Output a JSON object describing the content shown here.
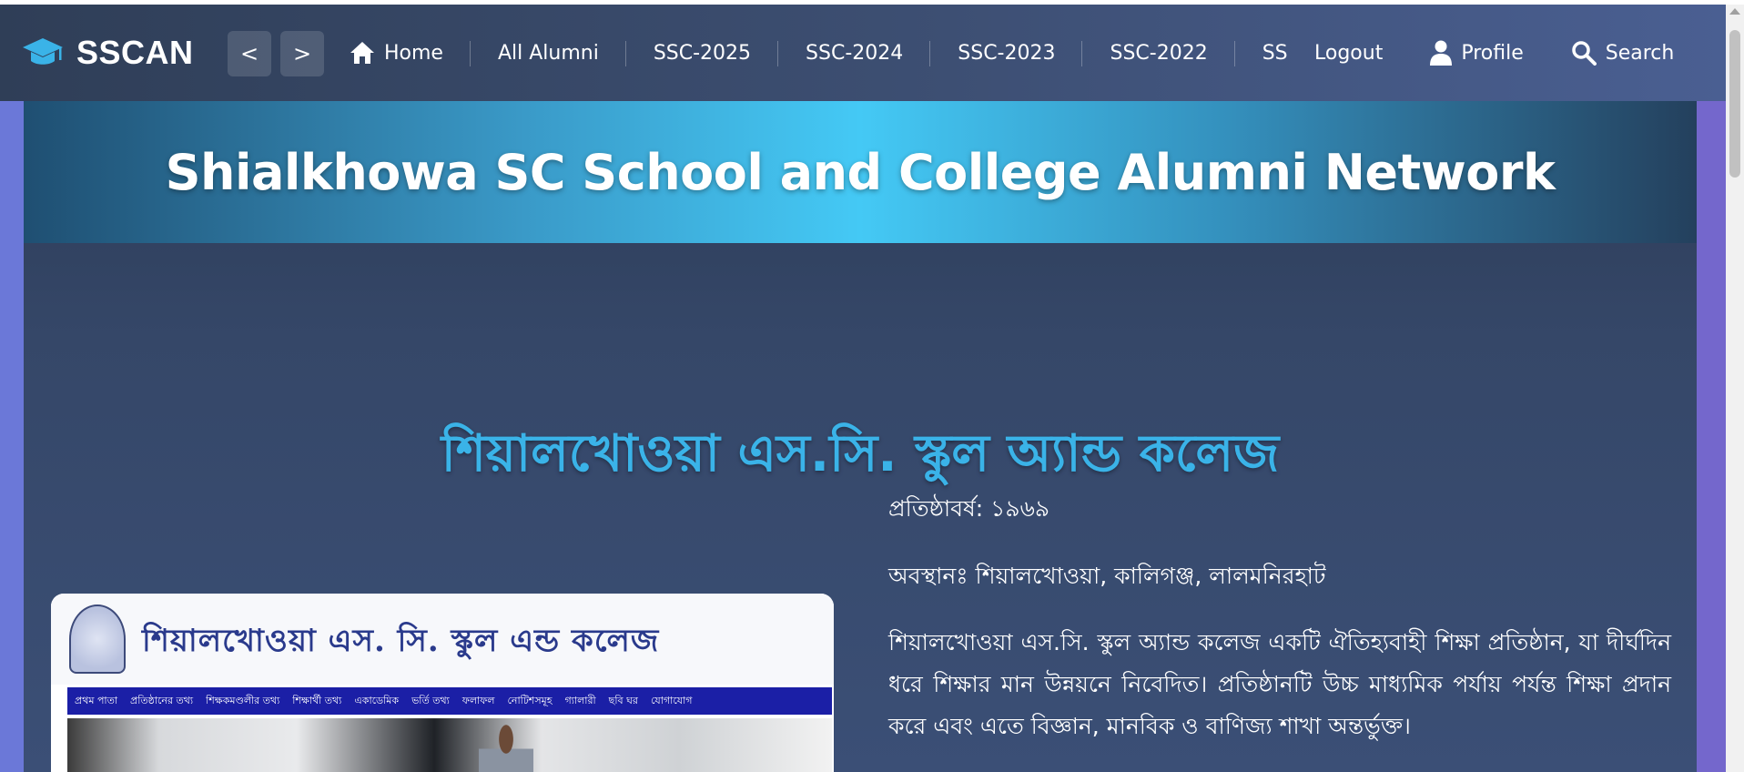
{
  "brand": {
    "name": "SSCAN",
    "icon": "graduation-cap-icon"
  },
  "nav": {
    "back_label": "<",
    "forward_label": ">",
    "items": [
      {
        "label": "Home",
        "icon": "home-icon"
      },
      {
        "label": "All Alumni"
      },
      {
        "label": "SSC-2025"
      },
      {
        "label": "SSC-2024"
      },
      {
        "label": "SSC-2023"
      },
      {
        "label": "SSC-2022"
      },
      {
        "label": "SSC-"
      }
    ],
    "logout_label": "Logout",
    "profile_label": "Profile",
    "search_label": "Search"
  },
  "hero": {
    "title": "Shialkhowa SC School and College Alumni Network"
  },
  "school": {
    "title": "শিয়ালখোওয়া এস.সি. স্কুল অ্যান্ড কলেজ",
    "established": "প্রতিষ্ঠাবর্ষ: ১৯৬৯",
    "location": "অবস্থানঃ শিয়ালখোওয়া, কালিগঞ্জ, লালমনিরহাট",
    "description": "শিয়ালখোওয়া এস.সি. স্কুল অ্যান্ড কলেজ একটি ঐতিহ্যবাহী শিক্ষা প্রতিষ্ঠান, যা দীর্ঘদিন ধরে শিক্ষার মান উন্নয়নে নিবেদিত। প্রতিষ্ঠানটি উচ্চ মাধ্যমিক পর্যায় পর্যন্ত শিক্ষা প্রদান করে এবং এতে বিজ্ঞান, মানবিক ও বাণিজ্য শাখা অন্তর্ভুক্ত।"
  },
  "website_preview": {
    "title": "শিয়ালখোওয়া এস. সি. স্কুল এন্ড কলেজ",
    "nav_items": [
      "প্রথম পাতা",
      "প্রতিষ্ঠানের তথ্য",
      "শিক্ষকমণ্ডলীর তথ্য",
      "শিক্ষার্থী তথ্য",
      "একাডেমিক",
      "ভর্তি তথ্য",
      "ফলাফল",
      "নোটিশসমূহ",
      "গ্যালারী",
      "ছবি ঘর",
      "যোগাযোগ"
    ]
  },
  "colors": {
    "navbar_start": "#2f3e57",
    "navbar_end": "#4a5f92",
    "hero_accent": "#44c9f5",
    "school_title": "#3ab3e8",
    "side_left": "#6b78d8",
    "side_right": "#7467cc"
  }
}
